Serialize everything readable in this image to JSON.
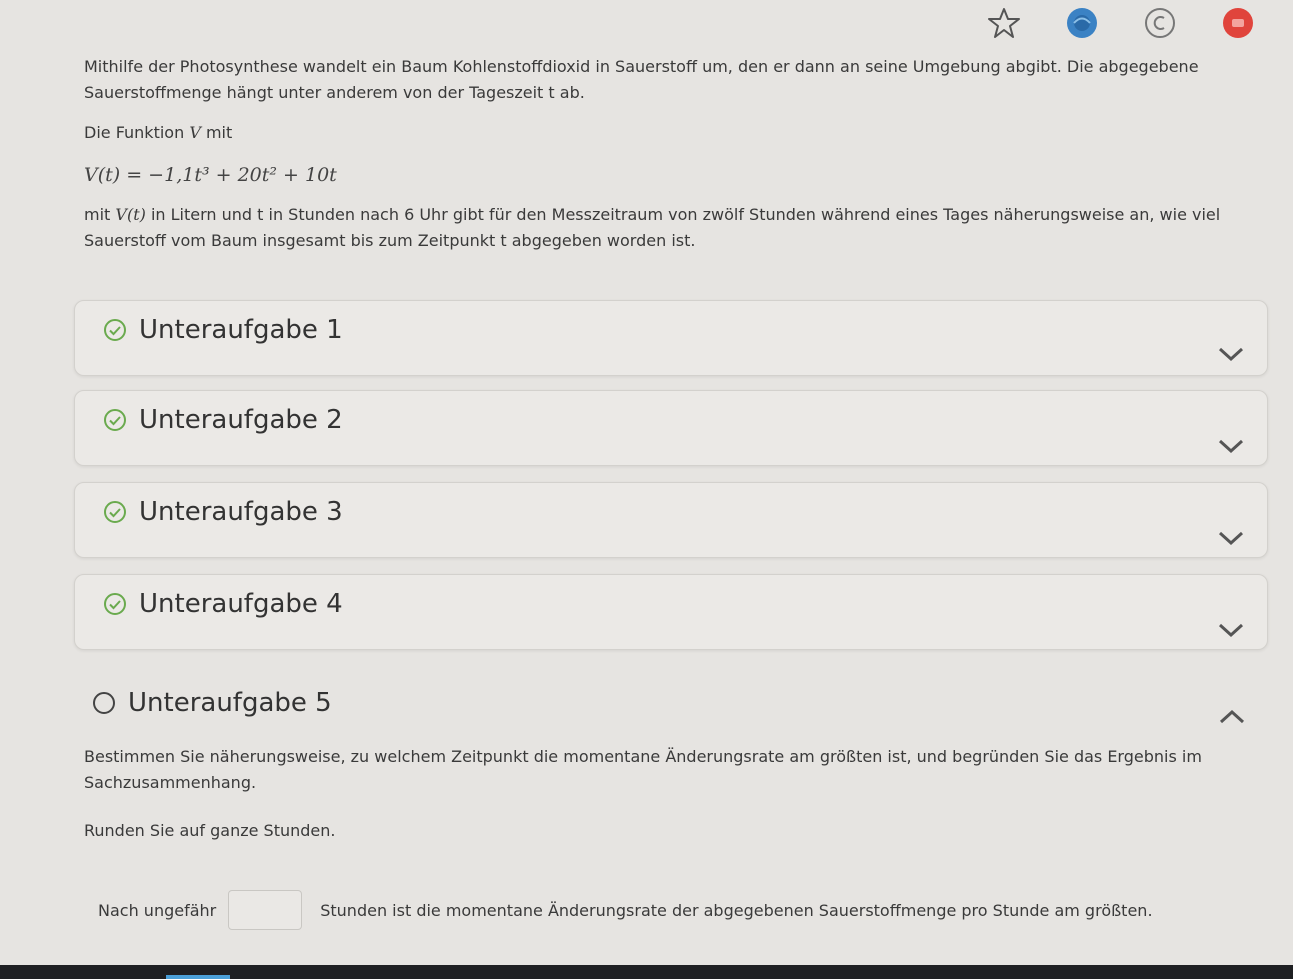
{
  "intro": {
    "p1": "Mithilfe der Photosynthese wandelt ein Baum Kohlenstoffdioxid in Sauerstoff um, den er dann an seine Umgebung abgibt. Die abgegebene Sauerstoffmenge hängt unter anderem von der Tageszeit t ab.",
    "p2_prefix": "Die Funktion ",
    "p2_var": "V",
    "p2_suffix": " mit",
    "formula": "V(t) = −1,1t³ + 20t² + 10t",
    "p3_prefix": "mit ",
    "p3_var": "V(t)",
    "p3_suffix": " in Litern und t in Stunden nach 6 Uhr gibt für den Messzeitraum von zwölf Stunden während eines Tages näherungsweise an, wie viel Sauerstoff vom Baum insgesamt bis zum Zeitpunkt t abgegeben worden ist."
  },
  "subtasks": [
    {
      "label": "Unteraufgabe 1",
      "status": "completed"
    },
    {
      "label": "Unteraufgabe 2",
      "status": "completed"
    },
    {
      "label": "Unteraufgabe 3",
      "status": "completed"
    },
    {
      "label": "Unteraufgabe 4",
      "status": "completed"
    }
  ],
  "active_subtask": {
    "label": "Unteraufgabe 5",
    "status": "open",
    "question": "Bestimmen Sie näherungsweise, zu welchem Zeitpunkt die momentane Änderungsrate am größten ist, und begründen Sie das Ergebnis im Sachzusammenhang.",
    "instruction": "Runden Sie auf ganze Stunden.",
    "answer_prefix": "Nach ungefähr",
    "answer_value": "",
    "answer_suffix": "Stunden ist die momentane Änderungsrate der abgegebenen Sauerstoffmenge pro Stunde am größten."
  },
  "colors": {
    "check": "#6aaa4e",
    "accent_blue": "#3b82c4",
    "record_red": "#e0443c"
  },
  "toolbar": {
    "icons": [
      "star-icon",
      "globe-icon",
      "copyright-icon",
      "record-icon"
    ]
  }
}
